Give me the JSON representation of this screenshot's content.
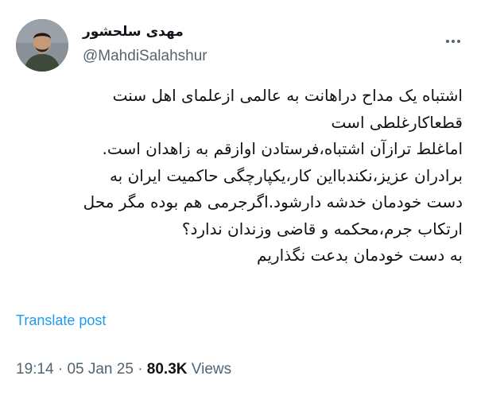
{
  "author": {
    "display_name": "مهدی سلحشور",
    "handle": "@MahdiSalahshur",
    "avatar_icon": "profile-photo"
  },
  "tweet": {
    "lines": [
      "اشتباه یک مداح دراهانت به عالمی ازعلمای اهل سنت",
      "قطعاکارغلطی است",
      "اماغلط ترازآن اشتباه،فرستادن اوازقم به زاهدان است.",
      "برادران عزیز،نکندبااین کار،یکپارچگی حاکمیت ایران به",
      "دست خودمان خدشه دارشود.اگرجرمی هم بوده مگر محل",
      "ارتکاب جرم،محکمه و قاضی وزندان ندارد؟",
      "به دست خودمان بدعت نگذاریم"
    ]
  },
  "translate_label": "Translate post",
  "meta": {
    "time": "19:14",
    "separator": "·",
    "date": "05 Jan 25",
    "views_count": "80.3K",
    "views_label": "Views"
  },
  "colors": {
    "text": "#0f1419",
    "secondary": "#536471",
    "link": "#1d9bf0"
  },
  "icons": {
    "more": "more-horizontal-icon"
  }
}
